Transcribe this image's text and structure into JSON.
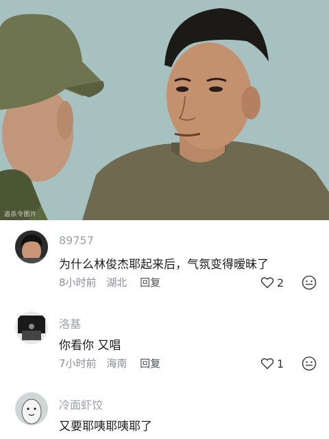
{
  "video": {
    "watermark": "追杀令图片"
  },
  "comments": [
    {
      "username": "89757",
      "text": "为什么林俊杰耶起来后，气氛变得暧昧了",
      "time": "8小时前",
      "location": "湖北",
      "reply_label": "回复",
      "like_count": "2"
    },
    {
      "username": "洛基",
      "text": "你看你 又唱",
      "time": "7小时前",
      "location": "海南",
      "reply_label": "回复",
      "like_count": "1"
    },
    {
      "username": "冷面虾饺",
      "text": "又要耶咦耶咦耶了"
    }
  ],
  "icons": {
    "like": "heart-outline-icon",
    "react": "smiley-face-icon"
  },
  "colors": {
    "username": "#9aa0a6",
    "comment_text": "#1c1c1c",
    "meta_text": "#8a8f95"
  }
}
